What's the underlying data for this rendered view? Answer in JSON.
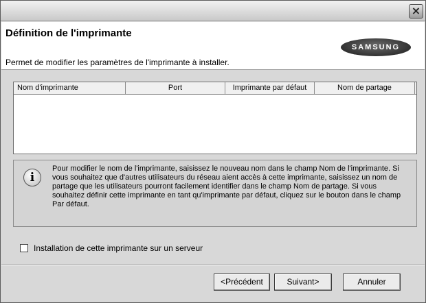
{
  "window": {
    "close_label": "×"
  },
  "header": {
    "title": "Définition de l'imprimante",
    "subtitle": "Permet de modifier les paramètres de l'imprimante à installer.",
    "logo_text": "SAMSUNG"
  },
  "table": {
    "columns": [
      "Nom d'imprimante",
      "Port",
      "Imprimante par défaut",
      "Nom de partage"
    ],
    "rows": []
  },
  "info": {
    "icon": "info-icon",
    "text": "Pour modifier le nom de l'imprimante, saisissez le nouveau nom dans le champ Nom de l'imprimante. Si vous souhaitez que d'autres utilisateurs du réseau aient accès à cette imprimante, saisissez un nom de partage que les utilisateurs pourront facilement identifier dans le champ Nom de partage. Si vous souhaitez définir cette imprimante en tant qu'imprimante par défaut, cliquez sur le bouton dans le champ Par défaut."
  },
  "options": {
    "server_install_label": "Installation de cette imprimante sur un serveur",
    "server_install_checked": false
  },
  "buttons": {
    "prev": "<Précédent",
    "next": "Suivant>",
    "cancel": "Annuler"
  }
}
